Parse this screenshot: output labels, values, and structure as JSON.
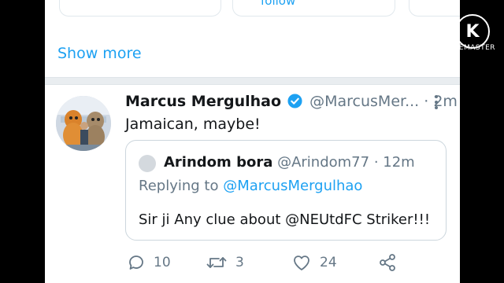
{
  "suggestions": {
    "follow_label": "follow"
  },
  "show_more": "Show more",
  "tweet": {
    "author_name": "Marcus Mergulhao",
    "author_handle": "@MarcusMer...",
    "separator": "·",
    "time": "2m",
    "text": "Jamaican, maybe!",
    "quote": {
      "author_name": "Arindom bora",
      "author_handle": "@Arindom77",
      "separator": "·",
      "time": "12m",
      "replying_to_label": "Replying to",
      "replying_to_handle": "@MarcusMergulhao",
      "text": "Sir ji Any clue about @NEUtdFC Striker!!!"
    },
    "actions": {
      "replies": "10",
      "retweets": "3",
      "likes": "24"
    }
  },
  "colors": {
    "accent": "#1da1f2",
    "text": "#14171a",
    "muted": "#657786"
  },
  "watermark": {
    "text": "KINEMASTER",
    "glyph": "K"
  }
}
